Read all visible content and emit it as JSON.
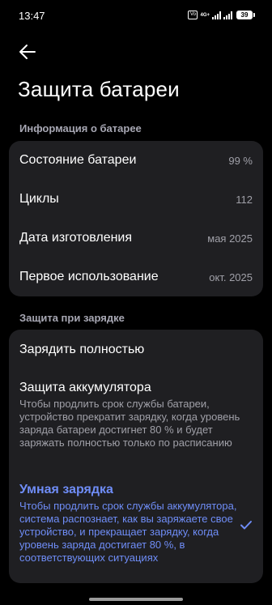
{
  "status_bar": {
    "time": "13:47",
    "sim_label": "Vo LTE",
    "network": "4G+",
    "battery": "39"
  },
  "header": {
    "title": "Защита батареи",
    "back_icon": "arrow-left-icon"
  },
  "battery_info": {
    "section_label": "Информация о батарее",
    "rows": [
      {
        "label": "Состояние батареи",
        "value": "99 %"
      },
      {
        "label": "Циклы",
        "value": "112"
      },
      {
        "label": "Дата изготовления",
        "value": "мая 2025"
      },
      {
        "label": "Первое использование",
        "value": "окт. 2025"
      }
    ]
  },
  "charging_protection": {
    "section_label": "Защита при зарядке",
    "options": [
      {
        "title": "Зарядить полностью",
        "description": "",
        "selected": false
      },
      {
        "title": "Защита аккумулятора",
        "description": "Чтобы продлить срок службы батареи, устройство прекратит зарядку, когда уровень заряда батареи достигнет 80 % и будет заряжать полностью только по расписанию",
        "selected": false
      },
      {
        "title": "Умная зарядка",
        "description": "Чтобы продлить срок службы аккумулятора, система распознает, как вы заряжаете свое устройство, и прекращает зарядку, когда уровень заряда достигает 80 %, в соответствующих ситуациях",
        "selected": true
      }
    ]
  },
  "colors": {
    "background": "#000000",
    "card": "#1f1f22",
    "accent": "#6f8df7",
    "secondary_text": "#a0a0a8"
  }
}
